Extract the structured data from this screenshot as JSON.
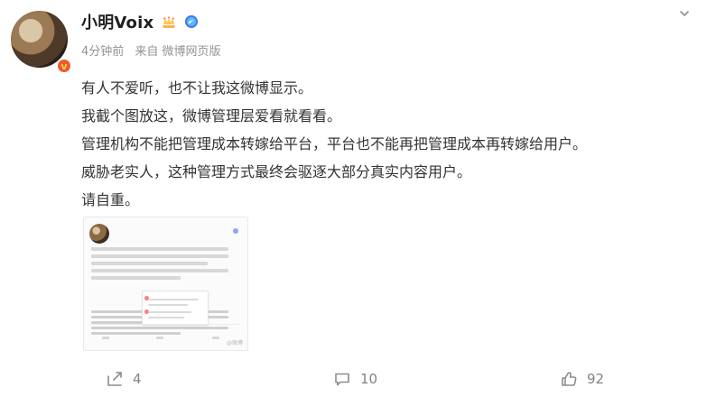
{
  "header": {
    "username": "小明Voix",
    "meta": {
      "time": "4分钟前",
      "source": "来自 微博网页版"
    }
  },
  "post": {
    "lines": [
      "有人不爱听，也不让我这微博显示。",
      "我截个图放这，微博管理层爱看就看看。",
      "管理机构不能把管理成本转嫁给平台，平台也不能再把管理成本再转嫁给用户。",
      "威胁老实人，这种管理方式最终会驱逐大部分真实内容用户。",
      "请自重。"
    ],
    "attachment": {
      "watermark": "@微博"
    }
  },
  "actions": {
    "share_count": "4",
    "comment_count": "10",
    "like_count": "92"
  },
  "icons": {
    "crown": "crown-icon",
    "vip": "vip-icon",
    "more": "chevron-down-icon",
    "share": "share-icon",
    "comment": "comment-icon",
    "like": "thumbs-up-icon"
  },
  "colors": {
    "text_primary": "#333333",
    "text_secondary": "#939393",
    "accent_orange": "#ef5b2c",
    "vip_blue": "#3b7ae6"
  }
}
